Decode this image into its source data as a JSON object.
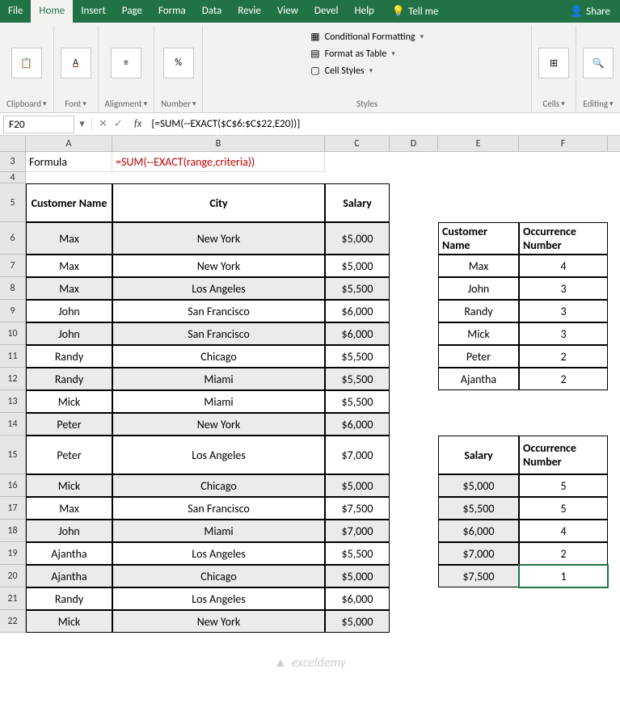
{
  "menu": {
    "tabs": [
      "File",
      "Home",
      "Insert",
      "Page",
      "Forma",
      "Data",
      "Revie",
      "View",
      "Devel",
      "Help"
    ],
    "active": "Home",
    "tell_me": "Tell me",
    "share": "Share"
  },
  "ribbon": {
    "clipboard": "Clipboard",
    "font": "Font",
    "alignment": "Alignment",
    "number": "Number",
    "styles": "Styles",
    "cells": "Cells",
    "editing": "Editing",
    "cond_fmt": "Conditional Formatting",
    "fmt_table": "Format as Table",
    "cell_styles": "Cell Styles"
  },
  "fxbar": {
    "namebox": "F20",
    "formula": "{=SUM(--EXACT($C$6:$C$22,E20))}"
  },
  "columns": [
    "A",
    "B",
    "C",
    "D",
    "E",
    "F"
  ],
  "row_nums": [
    3,
    4,
    5,
    6,
    7,
    8,
    9,
    10,
    11,
    12,
    13,
    14,
    15,
    16,
    17,
    18,
    19,
    20,
    21,
    22
  ],
  "a3": "Formula",
  "b3": "=SUM(--EXACT(range,criteria))",
  "headers_main": {
    "a": "Customer Name",
    "b": "City",
    "c": "Salary"
  },
  "data_main": [
    {
      "a": "Max",
      "b": "New York",
      "c": "$5,000"
    },
    {
      "a": "Max",
      "b": "New York",
      "c": "$5,000"
    },
    {
      "a": "Max",
      "b": "Los Angeles",
      "c": "$5,500"
    },
    {
      "a": "John",
      "b": "San Francisco",
      "c": "$6,000"
    },
    {
      "a": "John",
      "b": "San Francisco",
      "c": "$6,000"
    },
    {
      "a": "Randy",
      "b": "Chicago",
      "c": "$5,500"
    },
    {
      "a": "Randy",
      "b": "Miami",
      "c": "$5,500"
    },
    {
      "a": "Mick",
      "b": "Miami",
      "c": "$5,500"
    },
    {
      "a": "Peter",
      "b": "New York",
      "c": "$6,000"
    },
    {
      "a": "Peter",
      "b": "Los Angeles",
      "c": "$7,000"
    },
    {
      "a": "Mick",
      "b": "Chicago",
      "c": "$5,000"
    },
    {
      "a": "Max",
      "b": "San Francisco",
      "c": "$7,500"
    },
    {
      "a": "John",
      "b": "Miami",
      "c": "$7,000"
    },
    {
      "a": "Ajantha",
      "b": "Los Angeles",
      "c": "$5,500"
    },
    {
      "a": "Ajantha",
      "b": "Chicago",
      "c": "$5,000"
    },
    {
      "a": "Randy",
      "b": "Los Angeles",
      "c": "$6,000"
    },
    {
      "a": "Mick",
      "b": "New York",
      "c": "$5,000"
    }
  ],
  "headers_occ1": {
    "e": "Customer Name",
    "f": "Occurrence Number"
  },
  "data_occ1": [
    {
      "e": "Max",
      "f": "4"
    },
    {
      "e": "John",
      "f": "3"
    },
    {
      "e": "Randy",
      "f": "3"
    },
    {
      "e": "Mick",
      "f": "3"
    },
    {
      "e": "Peter",
      "f": "2"
    },
    {
      "e": "Ajantha",
      "f": "2"
    }
  ],
  "headers_occ2": {
    "e": "Salary",
    "f": "Occurrence Number"
  },
  "data_occ2": [
    {
      "e": "$5,000",
      "f": "5"
    },
    {
      "e": "$5,500",
      "f": "5"
    },
    {
      "e": "$6,000",
      "f": "4"
    },
    {
      "e": "$7,000",
      "f": "2"
    },
    {
      "e": "$7,500",
      "f": "1"
    }
  ],
  "watermark": "exceldemy"
}
